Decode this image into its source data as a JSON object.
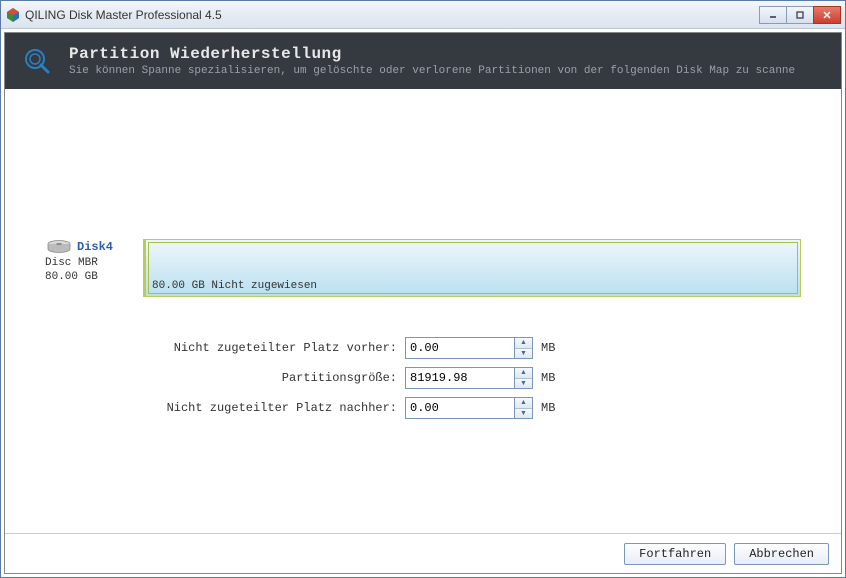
{
  "titlebar": {
    "title": "QILING Disk Master Professional 4.5"
  },
  "header": {
    "title": "Partition Wiederherstellung",
    "subtitle": "Sie können Spanne spezialisieren, um gelöschte oder verlorene Partitionen von der folgenden Disk Map zu scanne"
  },
  "disk": {
    "name": "Disk4",
    "type": "Disc MBR",
    "size": "80.00 GB",
    "bar_text": "80.00 GB Nicht zugewiesen"
  },
  "form": {
    "before_label": "Nicht zugeteilter Platz vorher:",
    "before_value": "0.00",
    "size_label": "Partitionsgröße:",
    "size_value": "81919.98",
    "after_label": "Nicht zugeteilter Platz nachher:",
    "after_value": "0.00",
    "unit": "MB"
  },
  "footer": {
    "continue": "Fortfahren",
    "cancel": "Abbrechen"
  }
}
